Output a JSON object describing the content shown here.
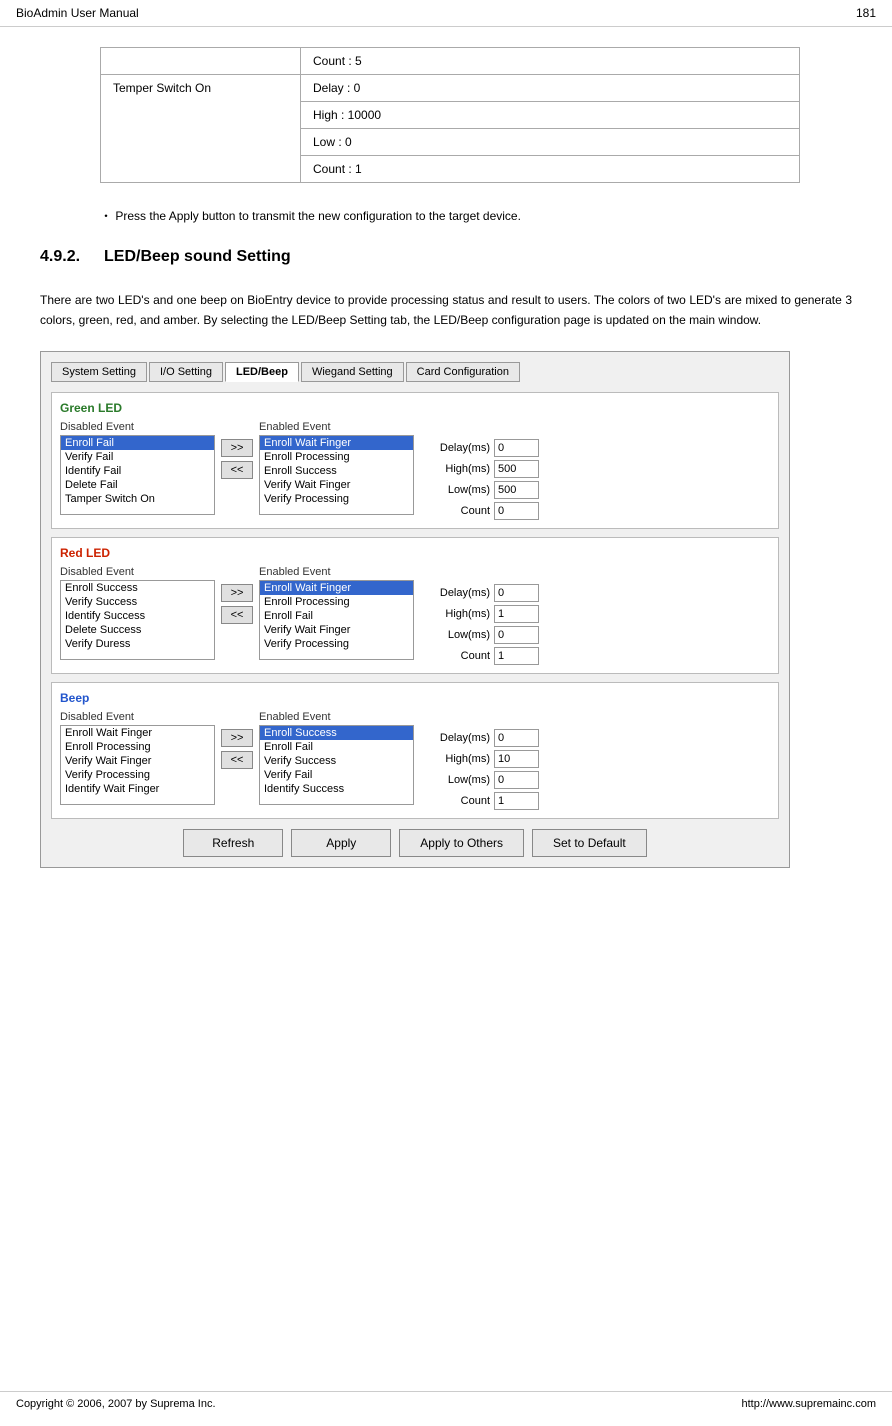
{
  "header": {
    "title": "BioAdmin  User  Manual",
    "page_number": "181"
  },
  "footer": {
    "copyright": "Copyright © 2006, 2007 by Suprema Inc.",
    "website": "http://www.supremainc.com"
  },
  "table": {
    "rows": [
      {
        "label": "",
        "values": [
          "Count : 5"
        ]
      },
      {
        "label": "Temper Switch On",
        "values": [
          "Delay : 0",
          "High : 10000",
          "Low : 0",
          "Count : 1"
        ]
      }
    ]
  },
  "bullet_text": "Press the Apply button to transmit the new configuration to the target device.",
  "section": {
    "number": "4.9.2.",
    "title": "LED/Beep sound Setting",
    "body": "There  are  two  LED's  and  one  beep  on  BioEntry  device  to  provide  processing status and result to users. The colors of two LED's are mixed to generate 3 colors, green,  red,  and  amber.  By  selecting  the  LED/Beep  Setting  tab,  the  LED/Beep configuration page is updated on the main window."
  },
  "tabs": [
    {
      "label": "System Setting",
      "active": false
    },
    {
      "label": "I/O Setting",
      "active": false
    },
    {
      "label": "LED/Beep",
      "active": true
    },
    {
      "label": "Wiegand Setting",
      "active": false
    },
    {
      "label": "Card Configuration",
      "active": false
    }
  ],
  "green_led": {
    "title": "Green LED",
    "disabled_label": "Disabled Event",
    "enabled_label": "Enabled Event",
    "disabled_items": [
      "Enroll Fail",
      "Verify Fail",
      "Identify Fail",
      "Delete Fail",
      "Tamper Switch On"
    ],
    "disabled_selected": "Enroll Fail",
    "enabled_items": [
      "Enroll Wait Finger",
      "Enroll Processing",
      "Enroll Success",
      "Verify Wait Finger",
      "Verify Processing"
    ],
    "enabled_selected": "Enroll Wait Finger",
    "params": [
      {
        "label": "Delay(ms)",
        "value": "0"
      },
      {
        "label": "High(ms)",
        "value": "500"
      },
      {
        "label": "Low(ms)",
        "value": "500"
      },
      {
        "label": "Count",
        "value": "0"
      }
    ]
  },
  "red_led": {
    "title": "Red LED",
    "disabled_label": "Disabled Event",
    "enabled_label": "Enabled Event",
    "disabled_items": [
      "Enroll Success",
      "Verify Success",
      "Identify Success",
      "Delete Success",
      "Verify Duress"
    ],
    "disabled_selected": null,
    "enabled_items": [
      "Enroll Wait Finger",
      "Enroll Processing",
      "Enroll Fail",
      "Verify Wait Finger",
      "Verify Processing"
    ],
    "enabled_selected": "Enroll Wait Finger",
    "params": [
      {
        "label": "Delay(ms)",
        "value": "0"
      },
      {
        "label": "High(ms)",
        "value": "1"
      },
      {
        "label": "Low(ms)",
        "value": "0"
      },
      {
        "label": "Count",
        "value": "1"
      }
    ]
  },
  "beep": {
    "title": "Beep",
    "disabled_label": "Disabled Event",
    "enabled_label": "Enabled Event",
    "disabled_items": [
      "Enroll Wait Finger",
      "Enroll Processing",
      "Verify Wait Finger",
      "Verify Processing",
      "Identify Wait Finger"
    ],
    "disabled_selected": null,
    "enabled_items": [
      "Enroll Success",
      "Enroll Fail",
      "Verify Success",
      "Verify Fail",
      "Identify Success"
    ],
    "enabled_selected": "Enroll Success",
    "params": [
      {
        "label": "Delay(ms)",
        "value": "0"
      },
      {
        "label": "High(ms)",
        "value": "10"
      },
      {
        "label": "Low(ms)",
        "value": "0"
      },
      {
        "label": "Count",
        "value": "1"
      }
    ]
  },
  "buttons": {
    "refresh": "Refresh",
    "apply": "Apply",
    "apply_others": "Apply to Others",
    "set_default": "Set to Default"
  },
  "arrows": {
    "right": ">>",
    "left": "<<"
  }
}
